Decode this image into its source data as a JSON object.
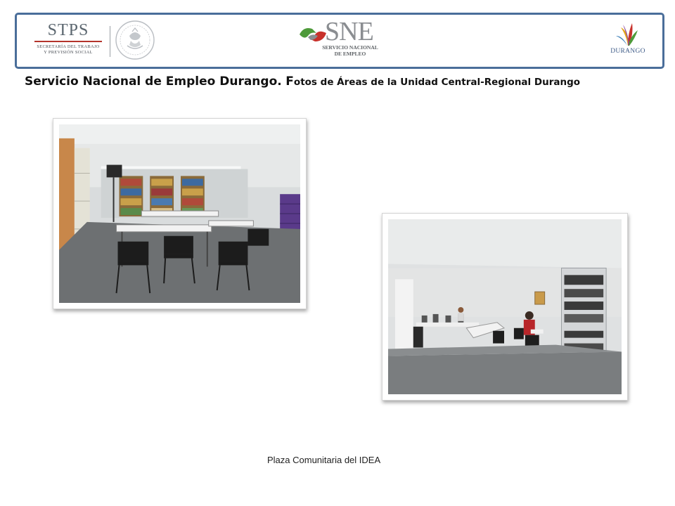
{
  "header": {
    "stps": {
      "mark": "STPS",
      "line1": "SECRETARÍA DEL TRABAJO",
      "line2": "Y PREVISIÓN SOCIAL"
    },
    "sne": {
      "mark": "SNE",
      "line1": "SERVICIO NACIONAL",
      "line2": "DE EMPLEO"
    },
    "durango": {
      "mark": "DURANGO"
    },
    "colors": {
      "frame": "#4a6e9a",
      "stps_red": "#b4342c",
      "sne_green": "#4e9a3a",
      "sne_red": "#c8312b",
      "durango_blue": "#3d5a87"
    }
  },
  "title": {
    "main": "Servicio Nacional de Empleo Durango.",
    "sub_initial": "F",
    "sub_rest": "otos de Áreas de la Unidad Central-Regional Durango"
  },
  "photos": [
    {
      "name": "photo-library-room",
      "icon": "classroom-photo"
    },
    {
      "name": "photo-computer-room",
      "icon": "computer-lab-photo"
    }
  ],
  "caption": "Plaza Comunitaria del IDEA"
}
